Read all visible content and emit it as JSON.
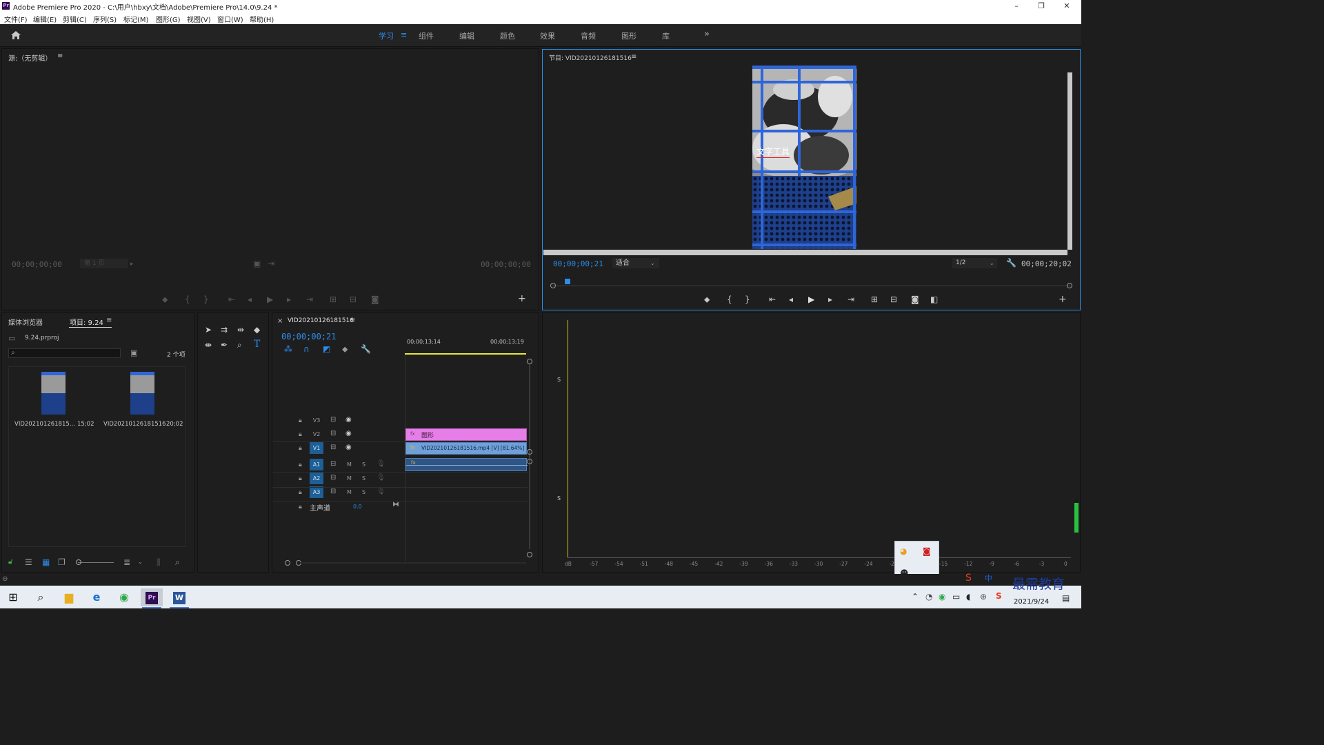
{
  "app": {
    "title": "Adobe Premiere Pro 2020 - C:\\用户\\hbxy\\文档\\Adobe\\Premiere Pro\\14.0\\9.24 *",
    "logo": "Pr"
  },
  "window_controls": {
    "minimize": "–",
    "restore": "❐",
    "close": "✕"
  },
  "menu": [
    "文件(F)",
    "编辑(E)",
    "剪辑(C)",
    "序列(S)",
    "标记(M)",
    "图形(G)",
    "视图(V)",
    "窗口(W)",
    "帮助(H)"
  ],
  "workspaces": {
    "items": [
      "学习",
      "组件",
      "编辑",
      "颜色",
      "效果",
      "音频",
      "图形",
      "库"
    ],
    "active": "学习",
    "menu_icon": "≡",
    "overflow": "»"
  },
  "source": {
    "title": "源:（无剪辑）",
    "menu_icon": "≡",
    "tc_left": "00;00;00;00",
    "page": "第 1 页",
    "tc_right": "00;00;00;00",
    "add": "+"
  },
  "program": {
    "title": "节目: VID20210126181516",
    "menu_icon": "≡",
    "overlay_text": "文字工具",
    "tc_current": "00;00;00;21",
    "fit": "适合",
    "resolution": "1/2",
    "tc_total": "00;00;20;02",
    "add": "+"
  },
  "project": {
    "tabs": [
      "媒体浏览器",
      "项目: 9.24"
    ],
    "menu_icon": "≡",
    "file": "9.24.prproj",
    "count": "2 个项",
    "search_placeholder": "",
    "items": [
      {
        "name": "VID202101261815...",
        "duration": "15;02"
      },
      {
        "name": "VID20210126181516",
        "duration": "20;02"
      }
    ]
  },
  "timeline": {
    "close": "×",
    "title": "VID20210126181516",
    "menu_icon": "≡",
    "tc": "00;00;00;21",
    "ruler": [
      "00;00;13;14",
      "00;00;13;19"
    ],
    "tracks": [
      {
        "name": "V3",
        "on": false
      },
      {
        "name": "V2",
        "on": false
      },
      {
        "name": "V1",
        "on": true
      },
      {
        "name": "A1",
        "on": true
      },
      {
        "name": "A2",
        "on": true
      },
      {
        "name": "A3",
        "on": true
      }
    ],
    "ms": {
      "m": "M",
      "s": "S"
    },
    "master": {
      "label": "主声道",
      "value": "0.0"
    },
    "clips": {
      "v2": "图形",
      "v1": "VID20210126181516.mp4 [V] [81.64%]",
      "fx": "fx"
    }
  },
  "audio_meter": {
    "s_labels": [
      "S",
      "S"
    ],
    "scale": [
      "dB",
      "-57",
      "-54",
      "-51",
      "-48",
      "-45",
      "-42",
      "-39",
      "-36",
      "-33",
      "-30",
      "-27",
      "-24",
      "-21",
      "-18",
      "-15",
      "-12",
      "-9",
      "-6",
      "-3",
      "0"
    ]
  },
  "taskbar": {
    "date": "2021/9/24",
    "ime": "中",
    "watermark": "最需教育"
  },
  "colors": {
    "accent": "#2d8ceb",
    "clip_graphic": "#e57ee6",
    "clip_video": "#6fa0d8",
    "audio_clip": "#3f6aa2",
    "playhead": "#e8e83a"
  }
}
